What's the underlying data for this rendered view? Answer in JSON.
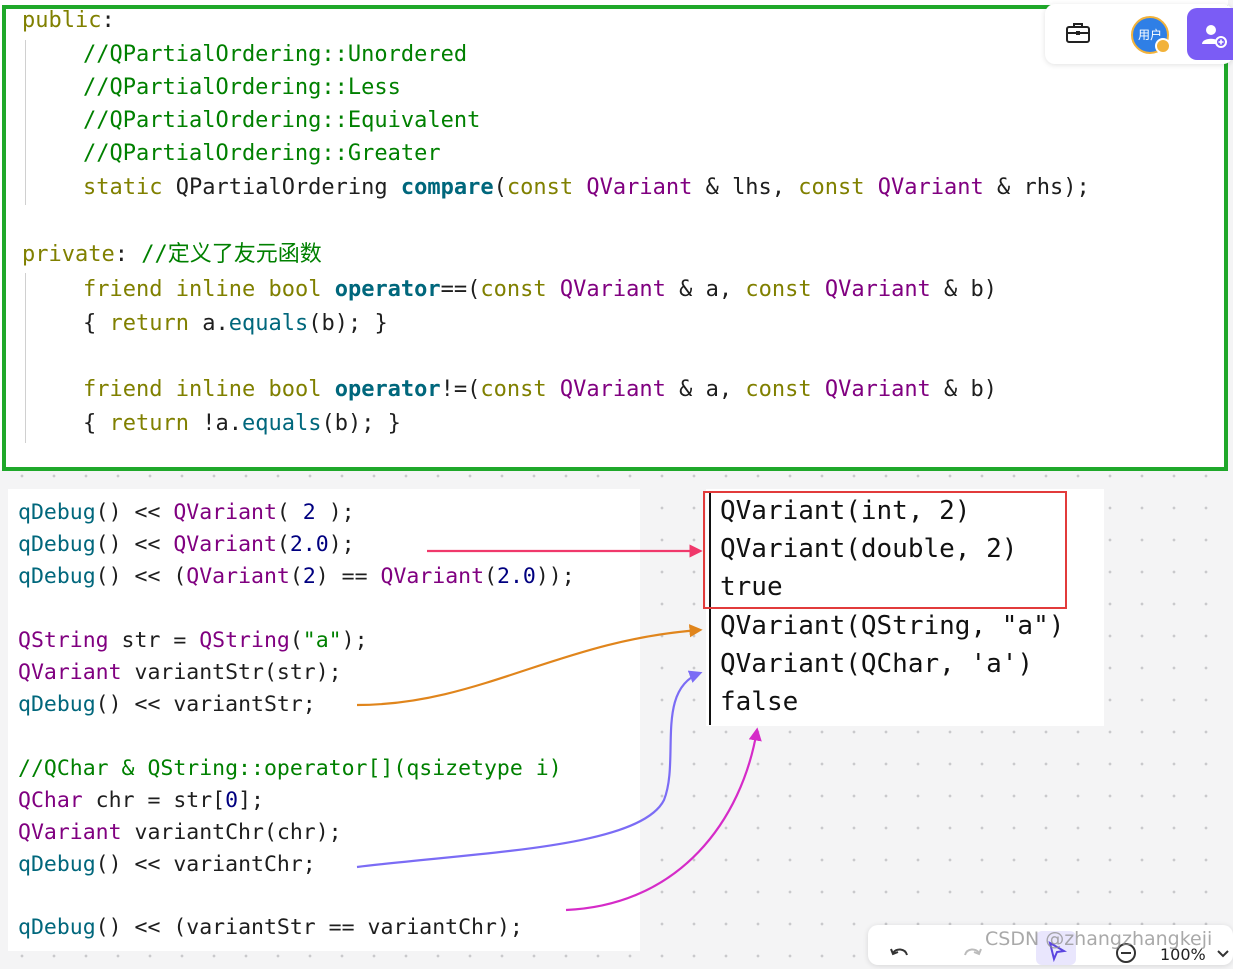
{
  "top_code": {
    "public_kw": "public",
    "colon": ":",
    "comment1": "//QPartialOrdering::Unordered",
    "comment2": "//QPartialOrdering::Less",
    "comment3": "//QPartialOrdering::Equivalent",
    "comment4": "//QPartialOrdering::Greater",
    "static_kw": "static",
    "qpo_type": "QPartialOrdering",
    "compare_fn": "compare",
    "paren_open": "(",
    "const_kw": "const",
    "qvariant_type": "QVariant",
    "amp_lhs": " & lhs, ",
    "amp_rhs": " & rhs);",
    "private_kw": "private",
    "private_comment": "//定义了友元函数",
    "friend_kw": "friend",
    "inline_kw": "inline",
    "bool_kw": "bool",
    "operator_kw": "operator",
    "eq_op": "==(",
    "neq_op": "!=(",
    "amp_a": " & a, ",
    "amp_b": " & b)",
    "brace_open": "{ ",
    "return_kw": "return",
    "a_var": " a.",
    "not_a_var": " !a.",
    "equals_fn": "equals",
    "b_arg": "(b); }"
  },
  "example_code": {
    "qdebug": "qDebug",
    "call_shift": "() << ",
    "qvariant": "QVariant",
    "line1_args_a": "( ",
    "line1_num": "2",
    "line1_args_b": " );",
    "line2_open": "(",
    "line2_num": "2.0",
    "line2_close": ");",
    "line3_open": "(",
    "line3_open2": "(",
    "line3_num1": "2",
    "line3_mid": ") == ",
    "line3_num2": "2.0",
    "line3_close": "));",
    "qstring": "QString",
    "str_decl": " str = ",
    "str_open": "(",
    "str_literal": "\"a\"",
    "str_close": ");",
    "variantstr_decl": " variantStr(str);",
    "variantstr": "variantStr;",
    "comment": "//QChar & QString::operator[](qsizetype i)",
    "qchar": "QChar",
    "chr_decl": " chr = str[",
    "chr_index": "0",
    "chr_close": "];",
    "variantchr_decl": " variantChr(chr);",
    "variantchr": "variantChr;",
    "compare_expr": "(variantStr == variantChr);"
  },
  "output": {
    "line1": "QVariant(int, 2)",
    "line2": "QVariant(double, 2)",
    "line3": "true",
    "line4": "QVariant(QString, \"a\")",
    "line5": "QVariant(QChar, 'a')",
    "line6": "false"
  },
  "toolbar": {
    "avatar_label": "用户"
  },
  "bottom_bar": {
    "zoom": "100%"
  },
  "watermark": "CSDN @zhangzhangkeji",
  "colors": {
    "green_border": "#1fa82a",
    "red_box": "#e23b3b",
    "arrow_red": "#f0386b",
    "arrow_orange": "#e0851c",
    "arrow_purple": "#7b6cf5",
    "arrow_magenta": "#d52bc8",
    "accent_purple": "#7b5cf5"
  }
}
